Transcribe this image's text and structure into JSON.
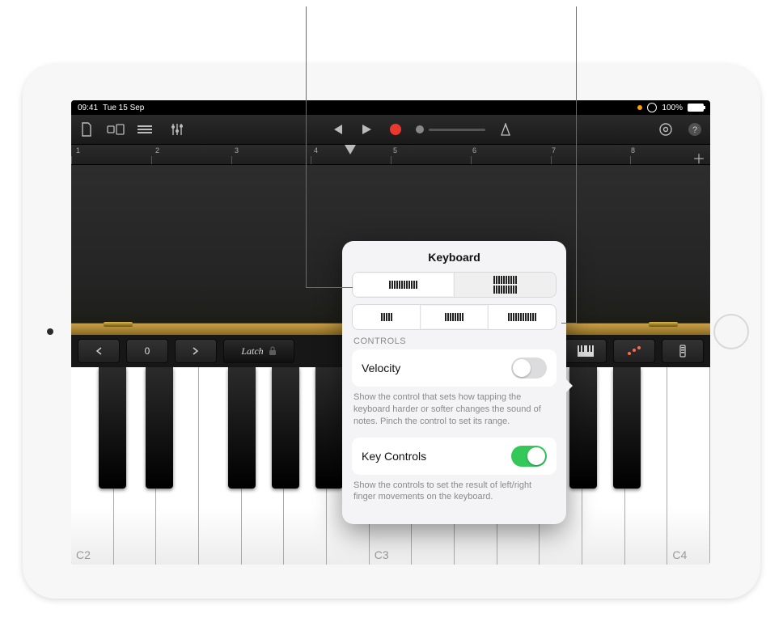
{
  "status": {
    "time": "09:41",
    "date": "Tue 15 Sep",
    "battery": "100%"
  },
  "ruler": {
    "marks": [
      "1",
      "2",
      "3",
      "4",
      "5",
      "6",
      "7",
      "8"
    ]
  },
  "strip": {
    "octave": "0",
    "latch": "Latch"
  },
  "keyboard": {
    "labels": [
      "C2",
      "C3",
      "C4"
    ]
  },
  "popover": {
    "title": "Keyboard",
    "section": "CONTROLS",
    "velocity": {
      "label": "Velocity",
      "desc": "Show the control that sets how tapping the keyboard harder or softer changes the sound of notes. Pinch the control to set its range."
    },
    "keycontrols": {
      "label": "Key Controls",
      "desc": "Show the controls to set the result of left/right finger movements on the keyboard."
    }
  }
}
